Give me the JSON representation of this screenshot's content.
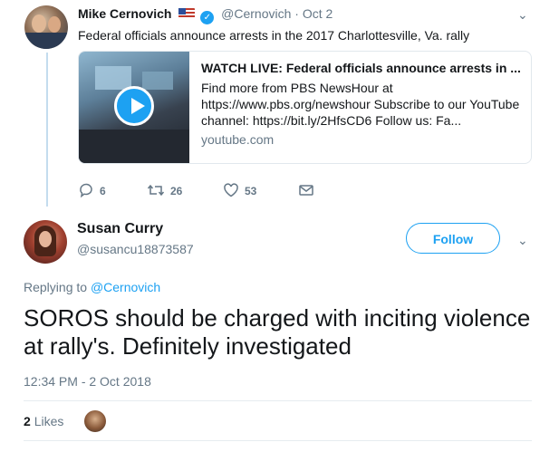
{
  "parent_tweet": {
    "author_name": "Mike Cernovich",
    "handle": "@Cernovich",
    "date": "Oct 2",
    "text": "Federal officials announce arrests in the 2017 Charlottesville, Va. rally",
    "card": {
      "title": "WATCH LIVE: Federal officials announce arrests in ...",
      "description": "Find more from PBS NewsHour at https://www.pbs.org/newshour Subscribe to our YouTube channel: https://bit.ly/2HfsCD6 Follow us: Fa...",
      "domain": "youtube.com"
    },
    "actions": {
      "replies": "6",
      "retweets": "26",
      "likes": "53"
    }
  },
  "main_tweet": {
    "author_name": "Susan Curry",
    "handle": "@susancu18873587",
    "follow_label": "Follow",
    "replying_prefix": "Replying to",
    "replying_to": "@Cernovich",
    "text": "SOROS should be charged with inciting violence at rally's. Definitely investigated",
    "timestamp": "12:34 PM - 2 Oct 2018",
    "likes_count": "2",
    "likes_label": "Likes"
  },
  "colors": {
    "accent": "#1da1f2",
    "secondary_text": "#657786",
    "primary_text": "#14171a"
  }
}
